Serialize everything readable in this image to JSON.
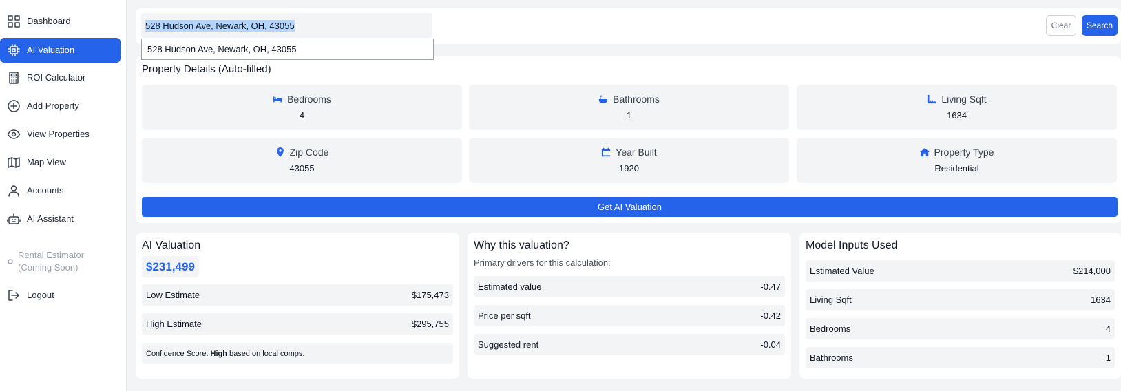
{
  "sidebar": {
    "items": [
      {
        "label": "Dashboard",
        "icon": "grid-icon"
      },
      {
        "label": "AI Valuation",
        "icon": "chip-icon",
        "active": true
      },
      {
        "label": "ROI Calculator",
        "icon": "calculator-icon"
      },
      {
        "label": "Add Property",
        "icon": "plus-circle-icon"
      },
      {
        "label": "View Properties",
        "icon": "eye-icon"
      },
      {
        "label": "Map View",
        "icon": "map-icon"
      },
      {
        "label": "Accounts",
        "icon": "user-icon"
      },
      {
        "label": "AI Assistant",
        "icon": "robot-icon"
      },
      {
        "label_line1": "Rental Estimator",
        "label_line2": "(Coming Soon)",
        "icon": "dot-icon",
        "disabled": true
      },
      {
        "label": "Logout",
        "icon": "logout-icon"
      }
    ]
  },
  "search": {
    "value": "528 Hudson Ave, Newark, OH, 43055",
    "suggestion": "528 Hudson Ave, Newark, OH, 43055",
    "clear_label": "Clear",
    "search_label": "Search"
  },
  "details": {
    "title": "Property Details (Auto-filled)",
    "tiles": [
      {
        "label": "Bedrooms",
        "value": "4",
        "icon": "bed-icon"
      },
      {
        "label": "Bathrooms",
        "value": "1",
        "icon": "bath-icon"
      },
      {
        "label": "Living Sqft",
        "value": "1634",
        "icon": "ruler-icon"
      },
      {
        "label": "Zip Code",
        "value": "43055",
        "icon": "pin-icon"
      },
      {
        "label": "Year Built",
        "value": "1920",
        "icon": "calendar-icon"
      },
      {
        "label": "Property Type",
        "value": "Residential",
        "icon": "home-icon"
      }
    ],
    "button_label": "Get AI Valuation"
  },
  "valuation": {
    "title": "AI Valuation",
    "value": "$231,499",
    "rows": [
      {
        "label": "Low Estimate",
        "value": "$175,473"
      },
      {
        "label": "High Estimate",
        "value": "$295,755"
      }
    ],
    "confidence_prefix": "Confidence Score:",
    "confidence_level": "High",
    "confidence_suffix": "based on local comps."
  },
  "why": {
    "title": "Why this valuation?",
    "subtitle": "Primary drivers for this calculation:",
    "rows": [
      {
        "label": "Estimated value",
        "value": "-0.47"
      },
      {
        "label": "Price per sqft",
        "value": "-0.42"
      },
      {
        "label": "Suggested rent",
        "value": "-0.04"
      }
    ]
  },
  "inputs": {
    "title": "Model Inputs Used",
    "rows": [
      {
        "label": "Estimated Value",
        "value": "$214,000"
      },
      {
        "label": "Living Sqft",
        "value": "1634"
      },
      {
        "label": "Bedrooms",
        "value": "4"
      },
      {
        "label": "Bathrooms",
        "value": "1"
      }
    ]
  },
  "colors": {
    "accent": "#2563eb",
    "background": "#f3f4f6",
    "card": "#ffffff"
  }
}
